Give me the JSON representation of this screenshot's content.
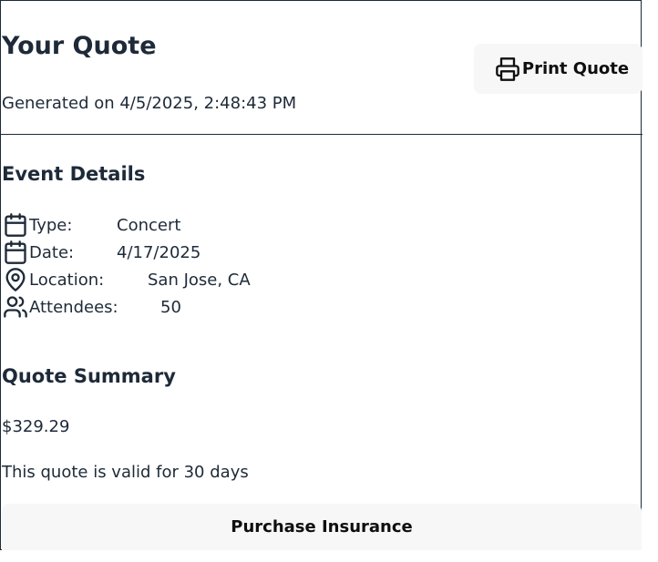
{
  "header": {
    "title": "Your Quote",
    "generated": "Generated on 4/5/2025, 2:48:43 PM",
    "print_label": "Print Quote",
    "print_icon": "printer-icon"
  },
  "event_details": {
    "title": "Event Details",
    "rows": [
      {
        "icon": "calendar-icon",
        "label": "Type:",
        "value": "Concert"
      },
      {
        "icon": "calendar-icon",
        "label": "Date:",
        "value": "4/17/2025"
      },
      {
        "icon": "map-pin-icon",
        "label": "Location:",
        "value": "San Jose, CA"
      },
      {
        "icon": "users-icon",
        "label": "Attendees:",
        "value": "50"
      }
    ]
  },
  "quote_summary": {
    "title": "Quote Summary",
    "price": "$329.29",
    "validity": "This quote is valid for 30 days"
  },
  "actions": {
    "purchase_label": "Purchase Insurance"
  },
  "colors": {
    "text": "#1e2a38",
    "button_bg": "#f7f7f7",
    "border": "#1e2a38"
  }
}
